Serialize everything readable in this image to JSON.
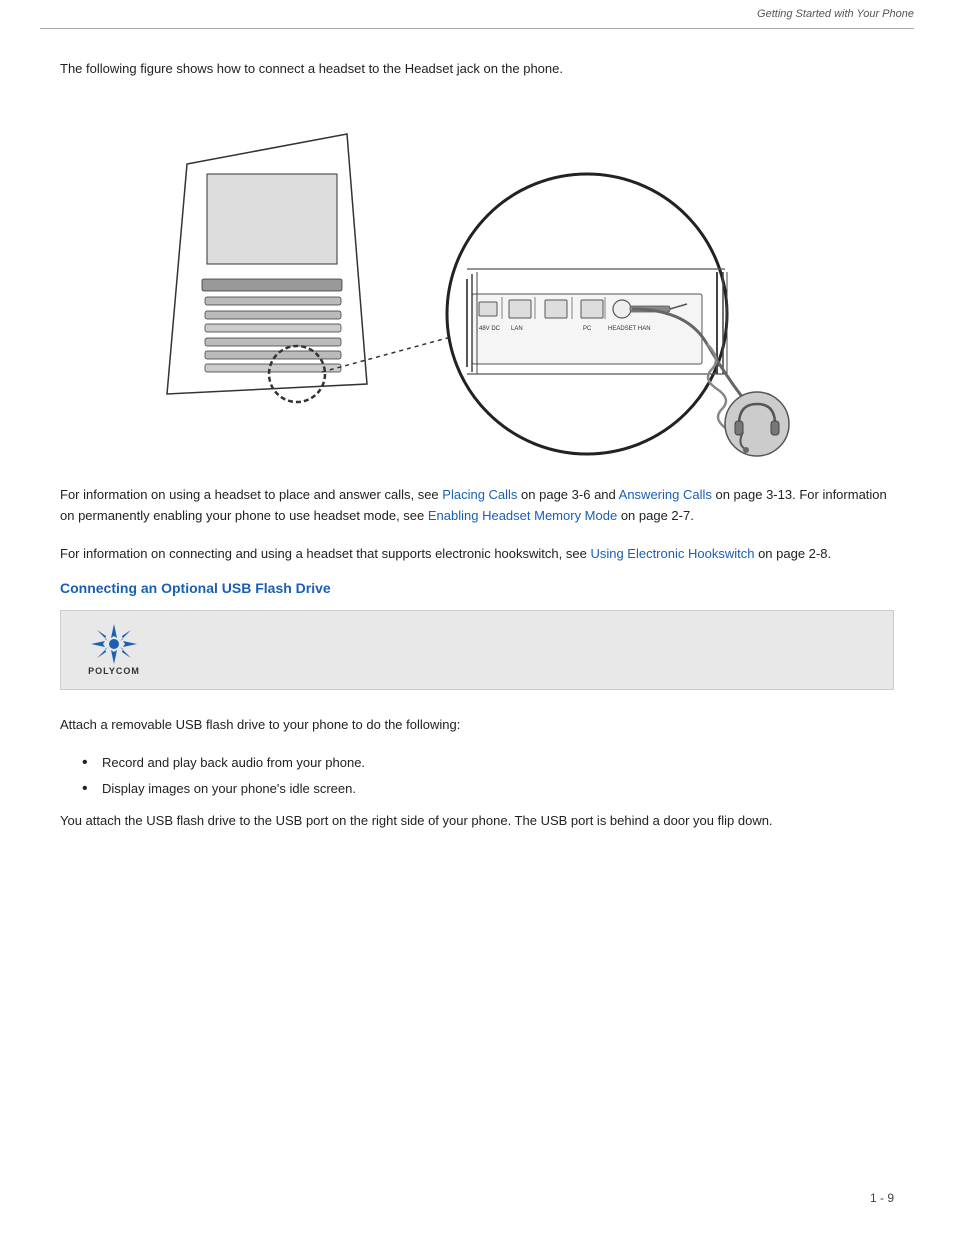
{
  "header": {
    "title": "Getting Started with Your Phone",
    "separator_color": "#bbbbbb"
  },
  "intro": {
    "text": "The following figure shows how to connect a headset to the Headset jack on the phone."
  },
  "info_block_1": {
    "text_before": "For information on using a headset to place and answer calls, see ",
    "link1": "Placing Calls",
    "text_middle1": " on page ",
    "ref1": "3-6",
    "text_and": " and ",
    "link2": "Answering Calls",
    "text_middle2": " on page ",
    "ref2": "3-13",
    "text_after": ". For information on permanently enabling your phone to use headset mode, see ",
    "link3": "Enabling Headset Memory Mode",
    "text_end": " on page ",
    "ref3": "2-7",
    "period": "."
  },
  "info_block_2": {
    "text_before": "For information on connecting and using a headset that supports electronic hookswitch, see ",
    "link": "Using Electronic Hookswitch",
    "text_after": " on page ",
    "ref": "2-8",
    "period": "."
  },
  "section_heading": "Connecting an Optional USB Flash Drive",
  "note_box": {
    "polycom_label": "POLYCOM",
    "content": ""
  },
  "attach_text": "Attach a removable USB flash drive to your phone to do the following:",
  "bullets": [
    "Record and play back audio from your phone.",
    "Display images on your phone's idle screen."
  ],
  "closing_text": "You attach the USB flash drive to the USB port on the right side of your phone. The USB port is behind a door you flip down.",
  "footer": {
    "page_number": "1 - 9"
  }
}
